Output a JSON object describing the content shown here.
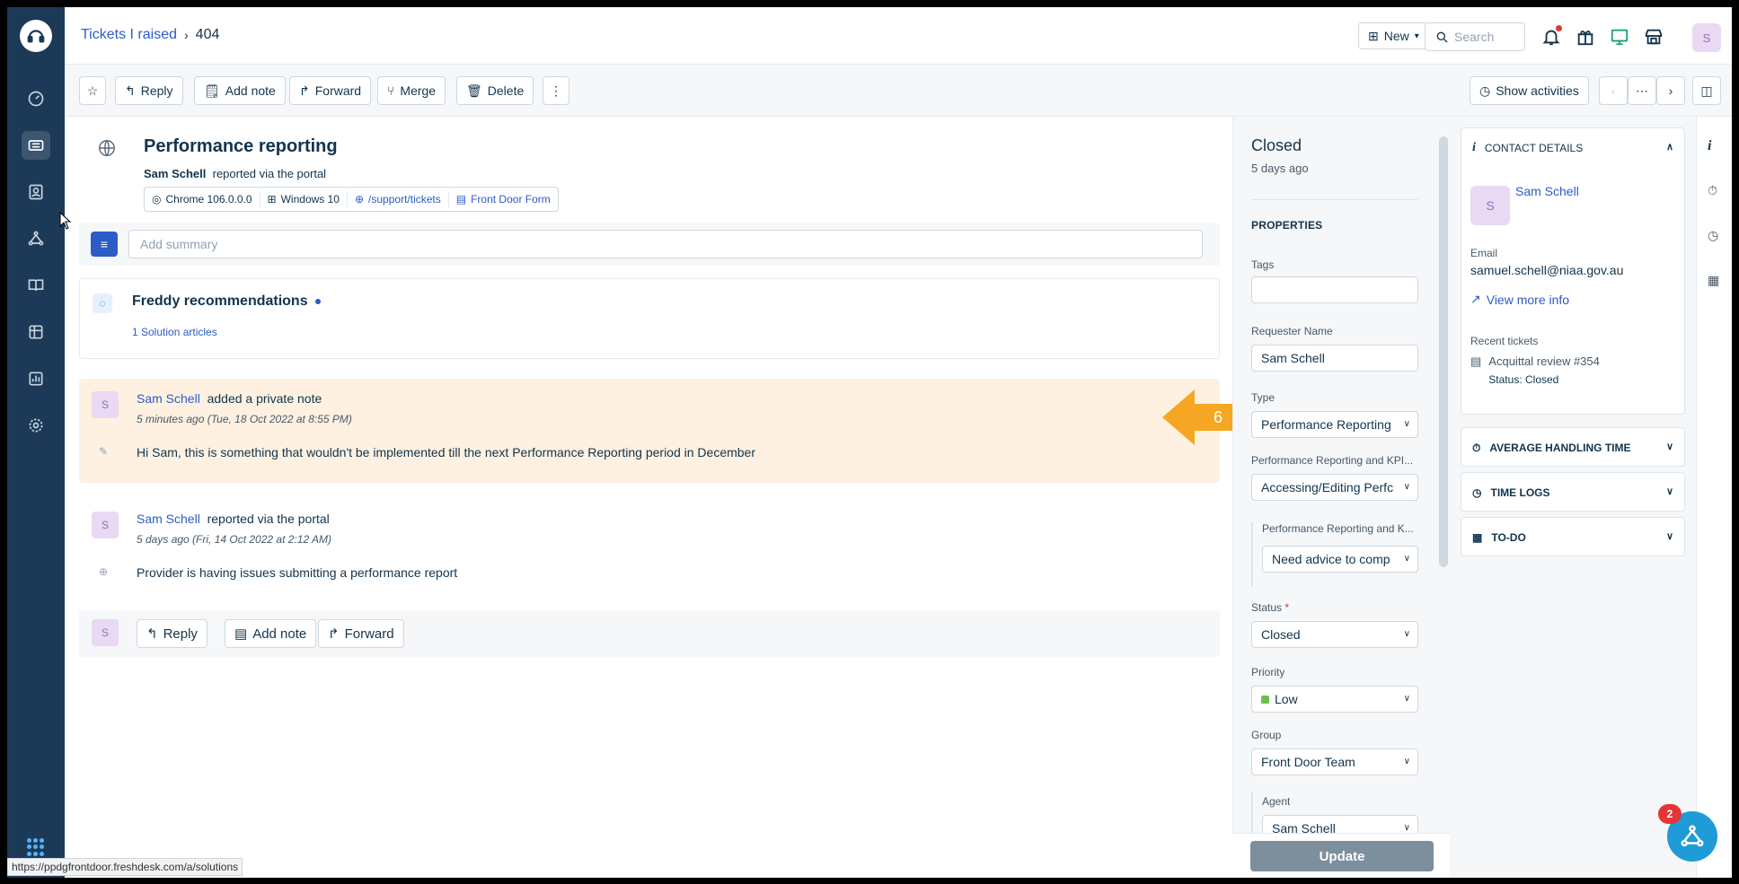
{
  "header": {
    "breadcrumb_parent": "Tickets I raised",
    "breadcrumb_current": "404",
    "new_label": "New",
    "search_placeholder": "Search",
    "avatar_initial": "S"
  },
  "toolbar": {
    "reply": "Reply",
    "add_note": "Add note",
    "forward": "Forward",
    "merge": "Merge",
    "delete": "Delete",
    "show_activities": "Show activities"
  },
  "ticket": {
    "subject": "Performance reporting",
    "requester": "Sam Schell",
    "reported_via": "reported via the portal",
    "browser": "Chrome 106.0.0.0",
    "os": "Windows 10",
    "url": "/support/tickets",
    "form": "Front Door Form",
    "summary_placeholder": "Add summary"
  },
  "freddy": {
    "title": "Freddy recommendations",
    "link": "1 Solution articles"
  },
  "conversations": [
    {
      "initial": "S",
      "name": "Sam Schell",
      "action": "added a private note",
      "time": "5 minutes ago (Tue, 18 Oct 2022 at 8:55 PM)",
      "body": "Hi Sam, this is something that wouldn't be implemented till the next Performance Reporting period in December"
    },
    {
      "initial": "S",
      "name": "Sam Schell",
      "action": "reported via the portal",
      "time": "5 days ago (Fri, 14 Oct 2022 at 2:12 AM)",
      "body": "Provider is having issues submitting a performance report"
    }
  ],
  "reply_bar": {
    "initial": "S",
    "reply": "Reply",
    "add_note": "Add note",
    "forward": "Forward"
  },
  "annotation": {
    "step": "6",
    "color": "#f5a623"
  },
  "properties": {
    "status_title": "Closed",
    "status_ago": "5 days ago",
    "section": "PROPERTIES",
    "tags_label": "Tags",
    "requester_label": "Requester Name",
    "requester_value": "Sam Schell",
    "type_label": "Type",
    "type_value": "Performance Reporting",
    "kpi_label": "Performance Reporting and KPI...",
    "kpi_value": "Accessing/Editing Perfc",
    "kpi_sub_label": "Performance Reporting and K...",
    "kpi_sub_value": "Need advice to comp",
    "status_label": "Status",
    "status_value": "Closed",
    "priority_label": "Priority",
    "priority_value": "Low",
    "group_label": "Group",
    "group_value": "Front Door Team",
    "agent_label": "Agent",
    "agent_value": "Sam Schell",
    "update": "Update"
  },
  "contact": {
    "header": "CONTACT DETAILS",
    "initial": "S",
    "name": "Sam Schell",
    "email_label": "Email",
    "email": "samuel.schell@niaa.gov.au",
    "view_more": "View more info",
    "recent_label": "Recent tickets",
    "recent_ticket": "Acquittal review #354",
    "recent_status_label": "Status:",
    "recent_status": "Closed"
  },
  "panels": {
    "aht": "AVERAGE HANDLING TIME",
    "time_logs": "TIME LOGS",
    "todo": "TO-DO"
  },
  "widget": {
    "badge": "2"
  },
  "statusbar": {
    "url": "https://ppdgfrontdoor.freshdesk.com/a/solutions"
  }
}
